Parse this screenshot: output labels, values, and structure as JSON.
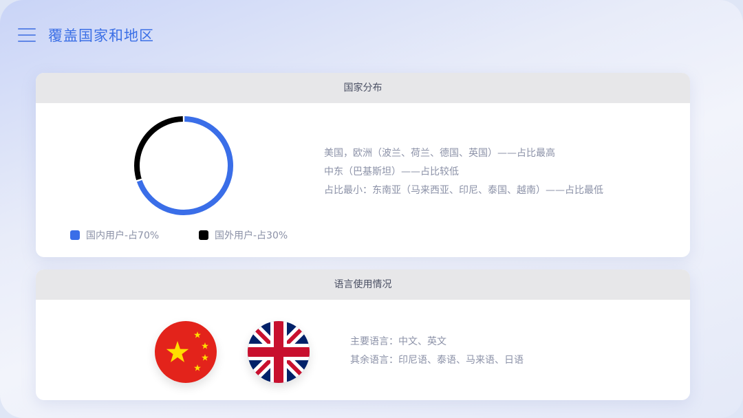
{
  "header": {
    "title": "覆盖国家和地区"
  },
  "country_card": {
    "title": "国家分布",
    "legend": [
      {
        "label": "国内用户-占70%",
        "color": "#3a6ee8"
      },
      {
        "label": "国外用户-占30%",
        "color": "#000000"
      }
    ],
    "lines": [
      "美国，欧洲（波兰、荷兰、德国、英国）——占比最高",
      "中东（巴基斯坦）——占比较低",
      "占比最小：东南亚（马来西亚、印尼、泰国、越南）——占比最低"
    ]
  },
  "chart_data": {
    "type": "pie",
    "categories": [
      "国内用户",
      "国外用户"
    ],
    "values": [
      70,
      30
    ],
    "colors": [
      "#3a6ee8",
      "#000000"
    ],
    "title": ""
  },
  "language_card": {
    "title": "语言使用情况",
    "flags": [
      {
        "icon": "china-flag-icon"
      },
      {
        "icon": "uk-flag-icon"
      }
    ],
    "lines": [
      "主要语言：中文、英文",
      "其余语言：印尼语、泰语、马来语、日语"
    ]
  }
}
